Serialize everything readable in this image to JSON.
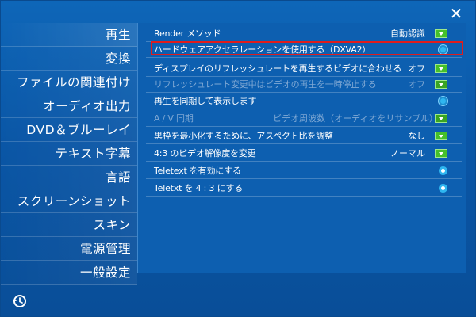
{
  "window": {
    "close_icon": "✕"
  },
  "sidebar": {
    "items": [
      {
        "label": "再生"
      },
      {
        "label": "変換"
      },
      {
        "label": "ファイルの関連付け"
      },
      {
        "label": "オーディオ出力"
      },
      {
        "label": "DVD＆ブルーレイ"
      },
      {
        "label": "テキスト字幕"
      },
      {
        "label": "言語"
      },
      {
        "label": "スクリーンショット"
      },
      {
        "label": "スキン"
      },
      {
        "label": "電源管理"
      },
      {
        "label": "一般設定"
      }
    ],
    "history_icon": "history-icon"
  },
  "settings": {
    "rows": [
      {
        "label": "Render メソッド",
        "value": "自動認識",
        "control": "dropdown",
        "disabled": false
      },
      {
        "label": "ハードウェアアクセラレーションを使用する（DXVA2）",
        "value": "",
        "control": "toggle",
        "disabled": false,
        "highlighted": true
      },
      {
        "label": "ディスプレイのリフレッシュレートを再生するビデオに合わせる",
        "value": "オフ",
        "control": "dropdown",
        "disabled": false
      },
      {
        "label": "リフレッシュレート変更中はビデオの再生を一時停止する",
        "value": "オフ",
        "control": "dropdown",
        "disabled": true
      },
      {
        "label": "再生を同期して表示します",
        "value": "",
        "control": "toggle",
        "disabled": false
      },
      {
        "label": "A / V 同期",
        "value": "ビデオ周波数（オーディオをリサンプル）",
        "control": "dropdown",
        "disabled": true
      },
      {
        "label": "黒枠を最小化するために、アスペクト比を調整",
        "value": "なし",
        "control": "dropdown",
        "disabled": false
      },
      {
        "label": "4:3 のビデオ解像度を変更",
        "value": "ノーマル",
        "control": "dropdown",
        "disabled": false
      },
      {
        "label": "Teletext を有効にする",
        "value": "",
        "control": "toggle",
        "disabled": false
      },
      {
        "label": "Teletxt を 4 : 3 にする",
        "value": "",
        "control": "toggle",
        "disabled": false
      }
    ]
  },
  "colors": {
    "background": "#0a58a8",
    "panel": "#0d5fb0",
    "dropdown_green": "#46c02a",
    "toggle_blue": "#2fb6f0",
    "highlight_red": "#e01c1c"
  }
}
